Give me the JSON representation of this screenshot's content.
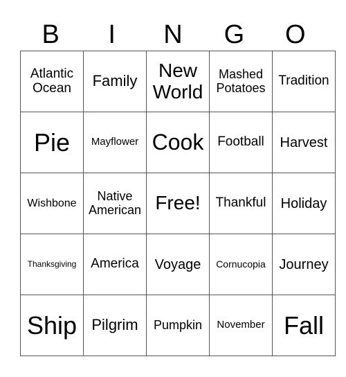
{
  "header": [
    "B",
    "I",
    "N",
    "G",
    "O"
  ],
  "cells": [
    [
      "Atlantic Ocean",
      "Family",
      "New World",
      "Mashed Potatoes",
      "Tradition"
    ],
    [
      "Pie",
      "Mayflower",
      "Cook",
      "Football",
      "Harvest"
    ],
    [
      "Wishbone",
      "Native American",
      "Free!",
      "Thankful",
      "Holiday"
    ],
    [
      "Thanksgiving",
      "America",
      "Voyage",
      "Cornucopia",
      "Journey"
    ],
    [
      "Ship",
      "Pilgrim",
      "Pumpkin",
      "November",
      "Fall"
    ]
  ]
}
